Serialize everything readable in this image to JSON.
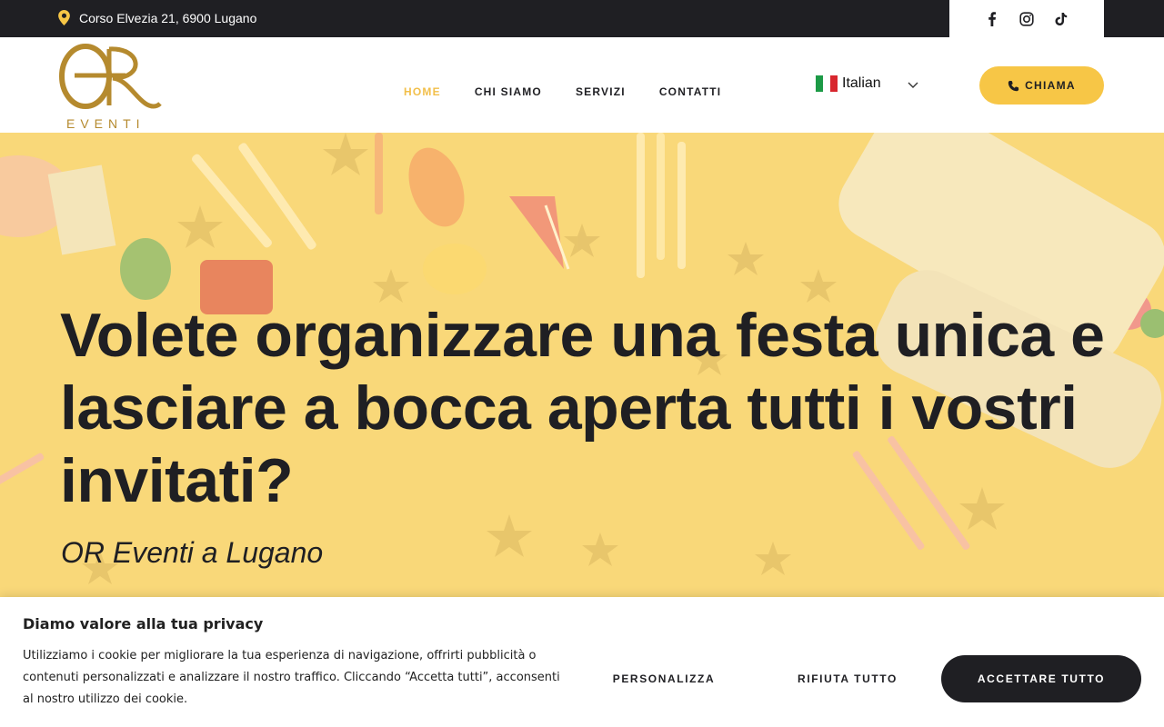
{
  "topbar": {
    "address": "Corso Elvezia 21, 6900 Lugano",
    "social": [
      "facebook-icon",
      "instagram-icon",
      "tiktok-icon"
    ]
  },
  "header": {
    "logo_word": "EVENTI",
    "nav": [
      {
        "label": "HOME",
        "active": true
      },
      {
        "label": "CHI SIAMO",
        "active": false
      },
      {
        "label": "SERVIZI",
        "active": false
      },
      {
        "label": "CONTATTI",
        "active": false
      }
    ],
    "language": "Italian",
    "call_label": "CHIAMA"
  },
  "hero": {
    "title": "Volete organizzare una festa unica e lasciare a bocca aperta tutti i vostri invitati?",
    "subtitle": "OR Eventi a Lugano"
  },
  "cookie": {
    "title": "Diamo valore alla tua privacy",
    "text": "Utilizziamo i cookie per migliorare la tua esperienza di navigazione, offrirti pubblicità o contenuti personalizzati e analizzare il nostro traffico. Cliccando “Accetta tutti”, acconsenti al nostro utilizzo dei cookie.",
    "customize_label": "PERSONALIZZA",
    "reject_label": "RIFIUTA TUTTO",
    "accept_label": "ACCETTARE TUTTO"
  },
  "colors": {
    "dark": "#1f1f23",
    "accent_yellow": "#f7c646",
    "gold": "#b58a2e",
    "nav_active": "#f2bf4a"
  }
}
